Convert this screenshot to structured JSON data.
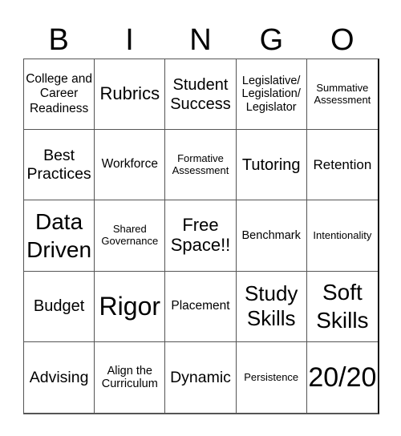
{
  "header": {
    "letters": [
      "B",
      "I",
      "N",
      "G",
      "O"
    ]
  },
  "board": {
    "rows": [
      [
        "College and Career Readiness",
        "Rubrics",
        "Student Success",
        "Legislative/ Legislation/ Legislator",
        "Summative Assessment"
      ],
      [
        "Best Practices",
        "Workforce",
        "Formative Assessment",
        "Tutoring",
        "Retention"
      ],
      [
        "Data Driven",
        "Shared Governance",
        "Free Space!!",
        "Benchmark",
        "Intentionality"
      ],
      [
        "Budget",
        "Rigor",
        "Placement",
        "Study Skills",
        "Soft Skills"
      ],
      [
        "Advising",
        "Align the Curriculum",
        "Dynamic",
        "Persistence",
        "20/20"
      ]
    ]
  }
}
